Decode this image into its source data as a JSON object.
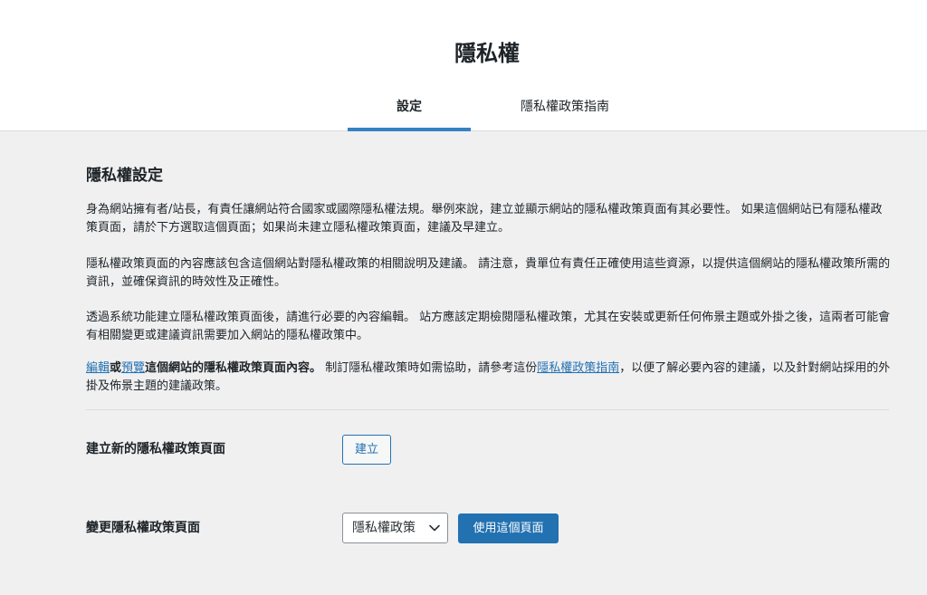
{
  "header": {
    "title": "隱私權",
    "tabs": [
      {
        "label": "設定",
        "active": true
      },
      {
        "label": "隱私權政策指南",
        "active": false
      }
    ]
  },
  "section": {
    "title": "隱私權設定",
    "paragraphs": [
      "身為網站擁有者/站長，有責任讓網站符合國家或國際隱私權法規。舉例來說，建立並顯示網站的隱私權政策頁面有其必要性。 如果這個網站已有隱私權政策頁面，請於下方選取這個頁面；如果尚未建立隱私權政策頁面，建議及早建立。",
      "隱私權政策頁面的內容應該包含這個網站對隱私權政策的相關說明及建議。 請注意，貴單位有責任正確使用這些資源，以提供這個網站的隱私權政策所需的資訊，並確保資訊的時效性及正確性。",
      "透過系統功能建立隱私權政策頁面後，請進行必要的內容編輯。 站方應該定期檢閱隱私權政策，尤其在安裝或更新任何佈景主題或外掛之後，這兩者可能會有相關變更或建議資訊需要加入網站的隱私權政策中。"
    ],
    "last_paragraph": {
      "edit_link": "編輯",
      "or_text": "或",
      "preview_link": "預覽",
      "bold_text": "這個網站的隱私權政策頁面內容。",
      "text_before_guide": " 制訂隱私權政策時如需協助，請參考這份",
      "guide_link": "隱私權政策指南",
      "text_after_guide": "，以便了解必要內容的建議，以及針對網站採用的外掛及佈景主題的建議政策。"
    }
  },
  "create_row": {
    "label": "建立新的隱私權政策頁面",
    "button": "建立"
  },
  "change_row": {
    "label": "變更隱私權政策頁面",
    "select_value": "隱私權政策",
    "button": "使用這個頁面"
  },
  "colors": {
    "accent": "#2271b1",
    "tab_underline": "#3582c4",
    "background": "#f0f0f1"
  }
}
